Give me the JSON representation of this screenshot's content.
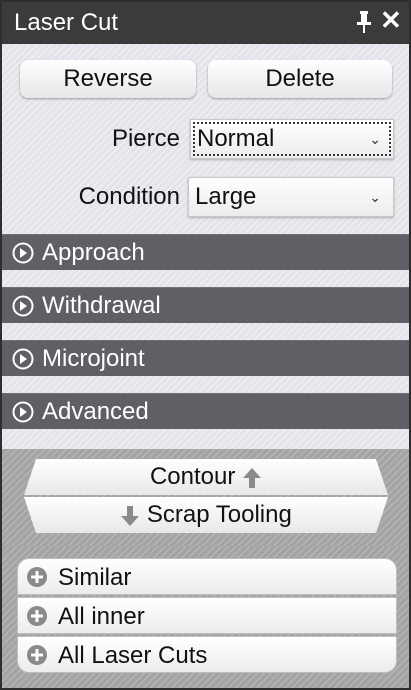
{
  "window": {
    "title": "Laser Cut"
  },
  "buttons": {
    "reverse": "Reverse",
    "delete": "Delete"
  },
  "pierce": {
    "label": "Pierce",
    "value": "Normal"
  },
  "condition": {
    "label": "Condition",
    "value": "Large"
  },
  "sections": [
    "Approach",
    "Withdrawal",
    "Microjoint",
    "Advanced"
  ],
  "direction": {
    "contour": "Contour",
    "scrap": "Scrap Tooling"
  },
  "add_list": [
    "Similar",
    "All inner",
    "All Laser Cuts"
  ],
  "icons": {
    "pin": "pin-icon",
    "close": "close-icon",
    "expand": "expand-circle-icon",
    "plus": "plus-circle-icon"
  }
}
